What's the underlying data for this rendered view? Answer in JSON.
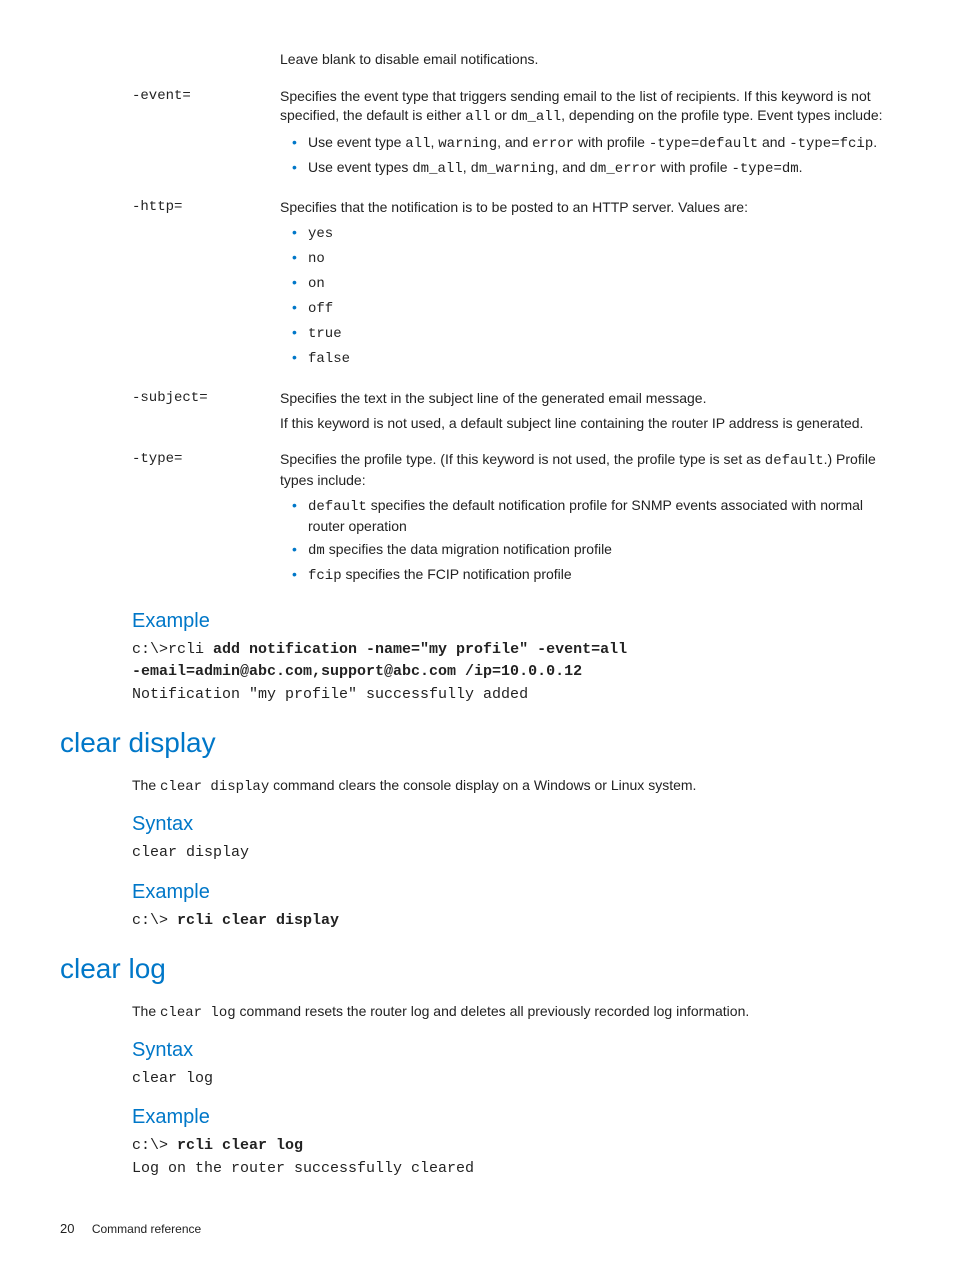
{
  "params": {
    "blank_note": "Leave blank to disable email notifications.",
    "event": {
      "key": "-event=",
      "desc_pre": "Specifies the event type that triggers sending email to the list of recipients. If this keyword is not specified, the default is either ",
      "desc_code1": "all",
      "desc_mid": " or ",
      "desc_code2": "dm_all",
      "desc_post": ", depending on the profile type. Event types include:",
      "b1_pre": "Use event type ",
      "b1_c1": "all",
      "b1_m1": ", ",
      "b1_c2": "warning",
      "b1_m2": ", and ",
      "b1_c3": "error",
      "b1_m3": " with profile ",
      "b1_c4": "-type=default",
      "b1_m4": " and ",
      "b1_c5": "-type=fcip",
      "b1_end": ".",
      "b2_pre": "Use event types ",
      "b2_c1": "dm_all",
      "b2_m1": ", ",
      "b2_c2": "dm_warning",
      "b2_m2": ", and ",
      "b2_c3": "dm_error",
      "b2_m3": " with profile ",
      "b2_c4": "-type=dm",
      "b2_end": "."
    },
    "http": {
      "key": "-http=",
      "desc": "Specifies that the notification is to be posted to an HTTP server. Values are:",
      "vals": [
        "yes",
        "no",
        "on",
        "off",
        "true",
        "false"
      ]
    },
    "subject": {
      "key": "-subject=",
      "l1": "Specifies the text in the subject line of the generated email message.",
      "l2": "If this keyword is not used, a default subject line containing the router IP address is generated."
    },
    "type": {
      "key": "-type=",
      "desc_pre": "Specifies the profile type. (If this keyword is not used, the profile type is set as ",
      "desc_code": "default",
      "desc_post": ".) Profile types include:",
      "b1_code": "default",
      "b1_text": " specifies the default notification profile for SNMP events associated with normal router operation",
      "b2_code": "dm",
      "b2_text": " specifies the data migration notification profile",
      "b3_code": "fcip",
      "b3_text": " specifies the FCIP notification profile"
    }
  },
  "example1": {
    "heading": "Example",
    "line1_prompt": "c:\\>rcli ",
    "line1_bold": "add notification -name=\"my profile\" -event=all",
    "line2_bold": "-email=admin@abc.com,support@abc.com /ip=10.0.0.12",
    "line3": "Notification \"my profile\" successfully added"
  },
  "clear_display": {
    "heading": "clear display",
    "desc_pre": "The ",
    "desc_code": "clear display",
    "desc_post": " command clears the console display on a Windows or Linux system.",
    "syntax_h": "Syntax",
    "syntax": "clear display",
    "example_h": "Example",
    "ex_prompt": "c:\\> ",
    "ex_bold": "rcli clear display"
  },
  "clear_log": {
    "heading": "clear log",
    "desc_pre": "The ",
    "desc_code": "clear log",
    "desc_post": " command resets the router log and deletes all previously recorded log information.",
    "syntax_h": "Syntax",
    "syntax": "clear log",
    "example_h": "Example",
    "ex_prompt": "c:\\> ",
    "ex_bold": "rcli clear log",
    "ex_out": "Log on the router successfully cleared"
  },
  "footer": {
    "page": "20",
    "title": "Command reference"
  }
}
